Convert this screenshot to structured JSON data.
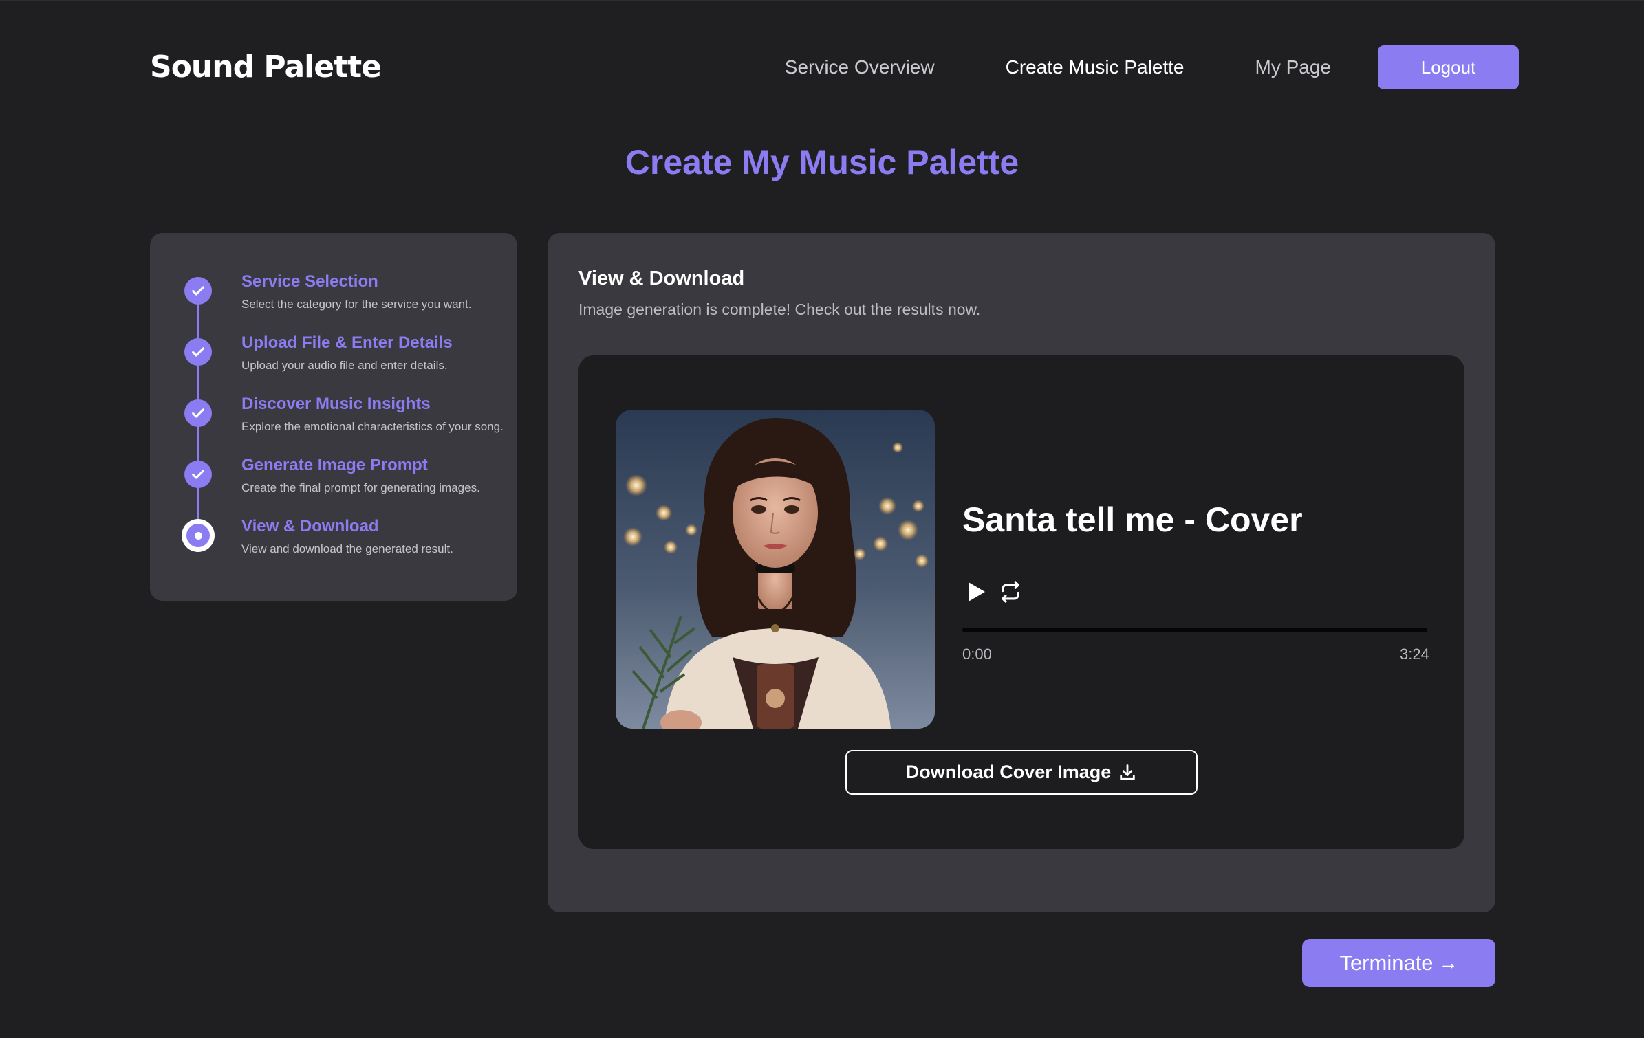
{
  "app": {
    "logo": "Sound Palette"
  },
  "nav": {
    "items": [
      {
        "label": "Service Overview",
        "active": false
      },
      {
        "label": "Create Music Palette",
        "active": true
      },
      {
        "label": "My Page",
        "active": false
      }
    ],
    "logout_label": "Logout"
  },
  "page_title": "Create My Music Palette",
  "steps": [
    {
      "title": "Service Selection",
      "desc": "Select the category for the service you want.",
      "status": "done"
    },
    {
      "title": "Upload File & Enter Details",
      "desc": "Upload your audio file and enter details.",
      "status": "done"
    },
    {
      "title": "Discover Music Insights",
      "desc": "Explore the emotional characteristics of your song.",
      "status": "done"
    },
    {
      "title": "Generate Image Prompt",
      "desc": "Create the final prompt for generating images.",
      "status": "done"
    },
    {
      "title": "View & Download",
      "desc": "View and download the generated result.",
      "status": "current"
    }
  ],
  "result": {
    "title": "View & Download",
    "subtitle": "Image generation is complete! Check out the results now.",
    "song_title": "Santa tell me - Cover",
    "current_time": "0:00",
    "duration": "3:24",
    "progress": 0,
    "download_label": "Download Cover Image"
  },
  "terminate_label": "Terminate",
  "colors": {
    "accent": "#8c7cf2",
    "background": "#1f1f22",
    "card": "#3a393f",
    "inner_panel": "#1d1d20"
  }
}
